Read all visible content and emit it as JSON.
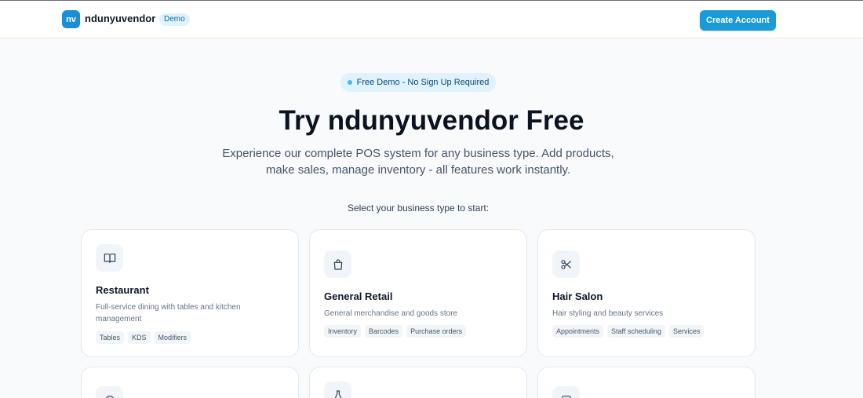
{
  "header": {
    "logo_text": "nv",
    "brand": "ndunyuvendor",
    "badge": "Demo",
    "create_account": "Create Account"
  },
  "hero": {
    "pill": "Free Demo - No Sign Up Required",
    "title": "Try ndunyuvendor Free",
    "subtitle": "Experience our complete POS system for any business type. Add products, make sales, manage inventory - all features work instantly."
  },
  "select_label": "Select your business type to start:",
  "cards": [
    {
      "icon": "book-icon",
      "title": "Restaurant",
      "description": "Full-service dining with tables and kitchen management",
      "tags": [
        "Tables",
        "KDS",
        "Modifiers"
      ]
    },
    {
      "icon": "shopping-bag-icon",
      "title": "General Retail",
      "description": "General merchandise and goods store",
      "tags": [
        "Inventory",
        "Barcodes",
        "Purchase orders"
      ]
    },
    {
      "icon": "scissors-icon",
      "title": "Hair Salon",
      "description": "Hair styling and beauty services",
      "tags": [
        "Appointments",
        "Staff scheduling",
        "Services"
      ]
    }
  ],
  "colors": {
    "accent": "#1b9ad8",
    "background": "#f8fafc"
  }
}
